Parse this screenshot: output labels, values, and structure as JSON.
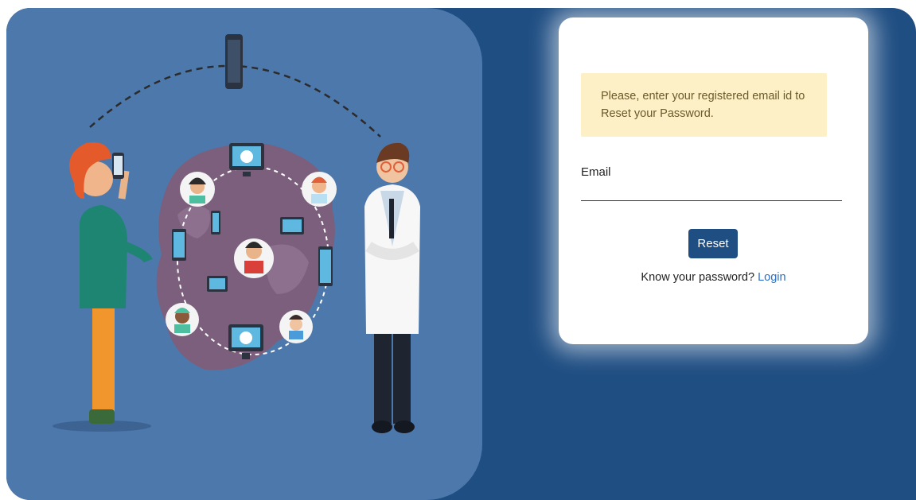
{
  "colors": {
    "background_dark": "#1f4e83",
    "illustration_bg": "#4d78ac",
    "alert_bg": "#fdf0c6",
    "button_bg": "#1f4e83",
    "link": "#2a6fc9"
  },
  "illustration": {
    "icons": [
      "person-with-phone",
      "doctor",
      "world-map",
      "network-avatars",
      "chat-monitor-icon",
      "smartphone-icon"
    ]
  },
  "form": {
    "alert_text": "Please, enter your registered email id to Reset your Password.",
    "email_label": "Email",
    "email_value": "",
    "reset_label": "Reset",
    "hint_text": "Know your password?",
    "login_link": "Login"
  }
}
